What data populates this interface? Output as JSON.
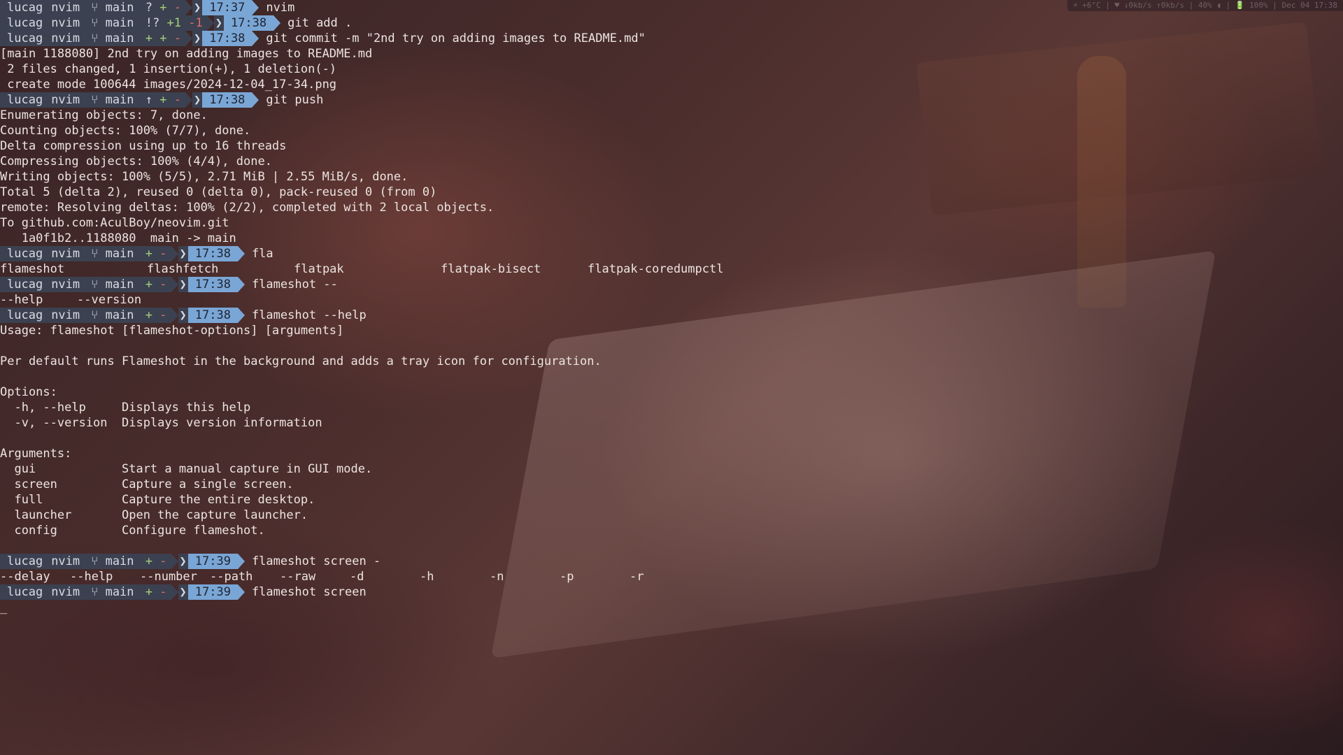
{
  "status_bar": "☀ +6°C  |  ♥ ↓0kb/s ↑0kb/s  |  40% ◖  |  🔋 100%  |  Dec 04 17:38",
  "prompt_user": "lucag",
  "prompt_dir": "nvim",
  "prompt_branch": "main",
  "prompts": [
    {
      "status": "? + -",
      "time": "17:37",
      "cmd": "nvim"
    },
    {
      "status": "!? +1 -1",
      "time": "17:38",
      "cmd": "git add ."
    },
    {
      "status": "+ + -",
      "time": "17:38",
      "cmd": "git commit -m \"2nd try on adding images to README.md\""
    },
    {
      "status": "↑ + -",
      "time": "17:38",
      "cmd": "git push"
    },
    {
      "status": "+ -",
      "time": "17:38",
      "cmd": "fla"
    },
    {
      "status": "+ -",
      "time": "17:38",
      "cmd": "flameshot --"
    },
    {
      "status": "+ -",
      "time": "17:38",
      "cmd": "flameshot --help"
    },
    {
      "status": "+ -",
      "time": "17:39",
      "cmd": "flameshot screen -"
    },
    {
      "status": "+ -",
      "time": "17:39",
      "cmd": "flameshot screen"
    }
  ],
  "commit_output": [
    "[main 1188080] 2nd try on adding images to README.md",
    " 2 files changed, 1 insertion(+), 1 deletion(-)",
    " create mode 100644 images/2024-12-04_17-34.png"
  ],
  "push_output": [
    "Enumerating objects: 7, done.",
    "Counting objects: 100% (7/7), done.",
    "Delta compression using up to 16 threads",
    "Compressing objects: 100% (4/4), done.",
    "Writing objects: 100% (5/5), 2.71 MiB | 2.55 MiB/s, done.",
    "Total 5 (delta 2), reused 0 (delta 0), pack-reused 0 (from 0)",
    "remote: Resolving deltas: 100% (2/2), completed with 2 local objects.",
    "To github.com:AculBoy/neovim.git",
    "   1a0f1b2..1188080  main -> main"
  ],
  "fla_completions": [
    "flameshot",
    "flashfetch",
    "flatpak",
    "flatpak-bisect",
    "flatpak-coredumpctl"
  ],
  "flameshot_flag_completions": [
    "--help",
    "--version"
  ],
  "help_output": [
    "Usage: flameshot [flameshot-options] [arguments]",
    "",
    "Per default runs Flameshot in the background and adds a tray icon for configuration.",
    "",
    "Options:",
    "  -h, --help     Displays this help",
    "  -v, --version  Displays version information",
    "",
    "Arguments:",
    "  gui            Start a manual capture in GUI mode.",
    "  screen         Capture a single screen.",
    "  full           Capture the entire desktop.",
    "  launcher       Open the capture launcher.",
    "  config         Configure flameshot.",
    ""
  ],
  "screen_completions": [
    "--delay",
    "--help",
    "--number",
    "--path",
    "--raw",
    "-d",
    "-h",
    "-n",
    "-p",
    "-r"
  ],
  "cursor": "_"
}
